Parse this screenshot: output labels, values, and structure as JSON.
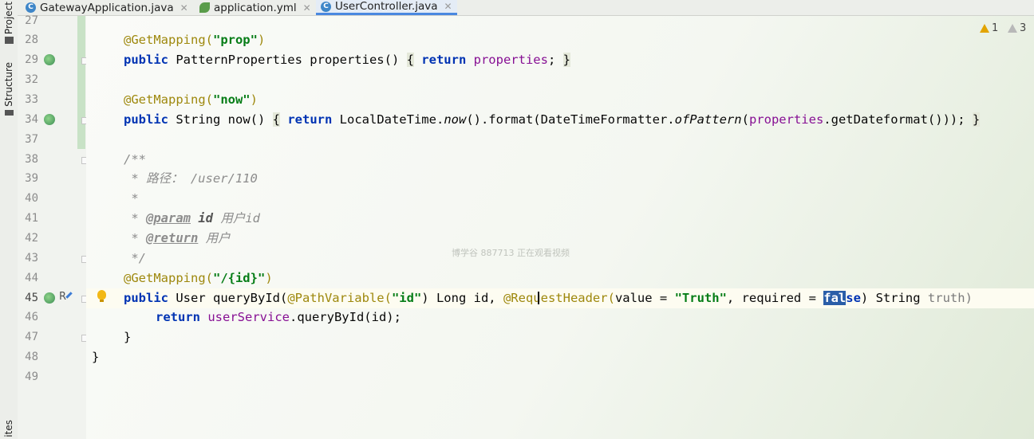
{
  "left_panel": {
    "project_label": "Project",
    "structure_label": "Structure",
    "bottom_label": "ites"
  },
  "tabs": [
    {
      "label": "GatewayApplication.java",
      "icon": "java-class-icon",
      "active": false
    },
    {
      "label": "application.yml",
      "icon": "yml-leaf-icon",
      "active": false
    },
    {
      "label": "UserController.java",
      "icon": "java-class-icon",
      "active": true
    }
  ],
  "inspections": {
    "warnings": "1",
    "weak_warnings": "3"
  },
  "line_numbers": [
    "27",
    "28",
    "29",
    "32",
    "33",
    "34",
    "37",
    "38",
    "39",
    "40",
    "41",
    "42",
    "43",
    "44",
    "45",
    "46",
    "47",
    "48",
    "49"
  ],
  "code": {
    "l28": {
      "ann": "@GetMapping(",
      "str": "\"prop\"",
      "close": ")"
    },
    "l29": {
      "kw1": "public",
      "sig": " PatternProperties properties() ",
      "ob": "{",
      "kw2": " return ",
      "fld": "properties",
      "semi": "; ",
      "cb": "}"
    },
    "l33": {
      "ann": "@GetMapping(",
      "str": "\"now\"",
      "close": ")"
    },
    "l34": {
      "kw1": "public",
      "sig": " String now() ",
      "ob": "{",
      "kw2": " return ",
      "p1": "LocalDateTime.",
      "now": "now",
      "p2": "().format(DateTimeFormatter.",
      "ofp": "ofPattern",
      "p3": "(",
      "fld": "properties",
      "p4": ".getDateformat())); ",
      "cb": "}"
    },
    "l38": "/**",
    "l39": " * 路径： /user/110",
    "l40": " *",
    "l41": {
      "pre": " * ",
      "tag": "@param",
      "name": " id",
      "desc": " 用户id"
    },
    "l42": {
      "pre": " * ",
      "tag": "@return",
      "desc": " 用户"
    },
    "l43": " */",
    "l44": {
      "ann": "@GetMapping(",
      "str": "\"/{id}\"",
      "close": ")"
    },
    "l45": {
      "kw1": "public",
      "p1": " User queryById(",
      "ann1": "@PathVariable(",
      "str1": "\"id\"",
      "p2": ") Long id, ",
      "ann2": "@RequestHeader(",
      "p3": "value = ",
      "str2": "\"Truth\"",
      "p4": ", required = ",
      "sel": "fal",
      "kwtail": "se",
      "p5": ") String ",
      "unused": "truth)"
    },
    "l46": {
      "kw": "return ",
      "fld": "userService",
      "rest": ".queryById(id);"
    },
    "l47": "}",
    "l48": "}"
  },
  "gutter_markers": {
    "l45_letter": "R"
  },
  "watermark": "博学谷 887713 正在观看视频"
}
